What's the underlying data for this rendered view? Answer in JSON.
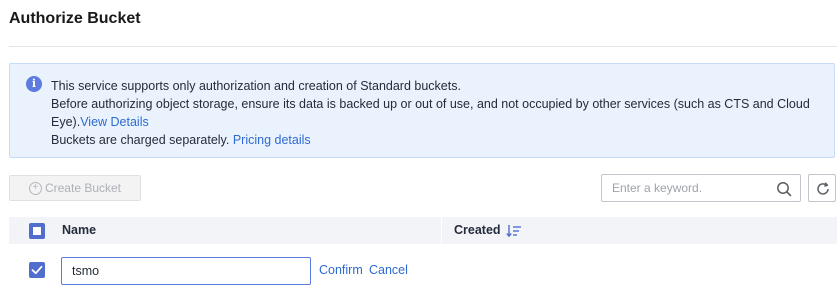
{
  "page": {
    "title": "Authorize Bucket"
  },
  "info": {
    "line1": "This service supports only authorization and creation of Standard buckets.",
    "line2": "Before authorizing object storage, ensure its data is backed up or out of use, and not occupied by other services (such as CTS and Cloud Eye).",
    "view_details": "View Details",
    "line3": "Buckets are charged separately. ",
    "pricing_details": "Pricing details"
  },
  "toolbar": {
    "create_label": "Create Bucket",
    "search_placeholder": "Enter a keyword."
  },
  "table": {
    "columns": [
      "Name",
      "Created"
    ],
    "rows": [
      {
        "name_value": "tsmo",
        "selected": true,
        "confirm": "Confirm",
        "cancel": "Cancel"
      }
    ]
  },
  "colors": {
    "accent": "#526ecc",
    "link": "#2e6ad1",
    "info_bg": "#eaf3fd"
  },
  "icons": [
    "info-icon",
    "plus-circle-icon",
    "search-icon",
    "refresh-icon",
    "sort-icon",
    "check-icon"
  ]
}
